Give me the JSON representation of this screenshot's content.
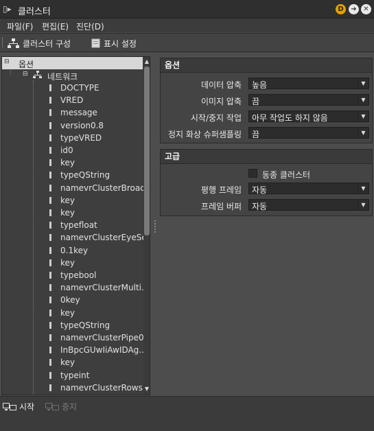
{
  "window": {
    "title": "클러스터"
  },
  "title_buttons": [
    {
      "label": "D",
      "color": "#e2a200"
    },
    {
      "label": "➜",
      "color": "#e8e8e8"
    },
    {
      "label": "✕",
      "color": "#e8e8e8"
    }
  ],
  "menu": [
    "파일(F)",
    "편집(E)",
    "진단(D)"
  ],
  "toolbar": {
    "cluster_config": "클러스터 구성",
    "display_settings": "표시 설정"
  },
  "tree": {
    "root": "옵션",
    "network": "네트워크",
    "items": [
      "DOCTYPE",
      "VRED",
      "message",
      "version0.8",
      "typeVRED",
      "id0",
      "key",
      "typeQString",
      "namevrClusterBroad...",
      "key",
      "key",
      "typefloat",
      "namevrClusterEyeSe...",
      "0.1key",
      "key",
      "typebool",
      "namevrClusterMulti...",
      "0key",
      "key",
      "typeQString",
      "namevrClusterPipe0",
      "InBpcGUwIiAwIDAg...",
      "key",
      "typeint",
      "namevrClusterRows"
    ]
  },
  "options": {
    "header": "옵션",
    "rows": [
      {
        "label": "데이터 압축",
        "value": "높음"
      },
      {
        "label": "이미지 압축",
        "value": "끔"
      },
      {
        "label": "시작/중지 작업",
        "value": "아무 작업도 하지 않음"
      },
      {
        "label": "정지 화상 슈퍼샘플링",
        "value": "끔"
      }
    ]
  },
  "advanced": {
    "header": "고급",
    "sync_label": "동종 클러스터",
    "rows": [
      {
        "label": "평행 프레임",
        "value": "자동"
      },
      {
        "label": "프레임 버퍼",
        "value": "자동"
      }
    ]
  },
  "bottom": {
    "start": "시작",
    "stop": "중지"
  }
}
